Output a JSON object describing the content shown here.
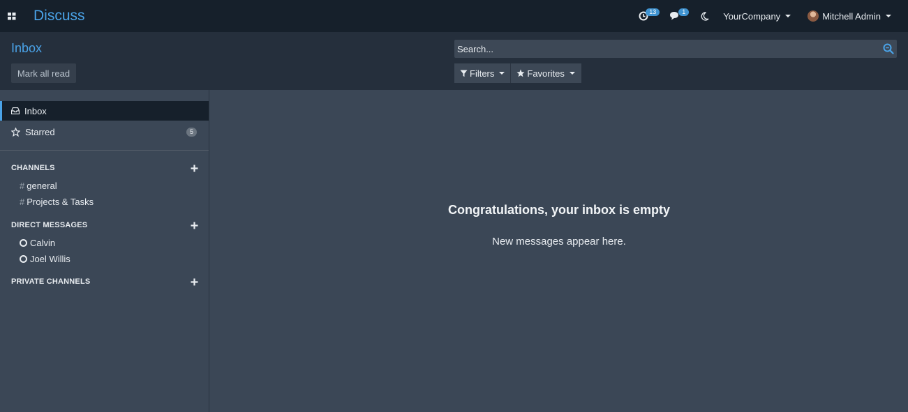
{
  "navbar": {
    "app_name": "Discuss",
    "activity_count": "13",
    "messaging_count": "1",
    "company": "YourCompany",
    "user": "Mitchell Admin"
  },
  "control_panel": {
    "title": "Inbox",
    "mark_all_read": "Mark all read",
    "search_placeholder": "Search...",
    "filters_label": "Filters",
    "favorites_label": "Favorites"
  },
  "sidebar": {
    "mailboxes": [
      {
        "label": "Inbox",
        "icon": "inbox-icon",
        "active": true
      },
      {
        "label": "Starred",
        "icon": "star-icon",
        "counter": "5"
      }
    ],
    "categories": {
      "channels": {
        "title": "CHANNELS",
        "items": [
          "general",
          "Projects & Tasks"
        ]
      },
      "direct_messages": {
        "title": "DIRECT MESSAGES",
        "items": [
          "Calvin",
          "Joel Willis"
        ]
      },
      "private_channels": {
        "title": "PRIVATE CHANNELS",
        "items": []
      }
    }
  },
  "content": {
    "empty_title": "Congratulations, your inbox is empty",
    "empty_subtitle": "New messages appear here."
  },
  "colors": {
    "navbar_bg": "#16202b",
    "control_panel_bg": "#252f3c",
    "body_bg": "#3b4756",
    "accent": "#4aa3e8",
    "counter_badge": "#3f93d1"
  }
}
